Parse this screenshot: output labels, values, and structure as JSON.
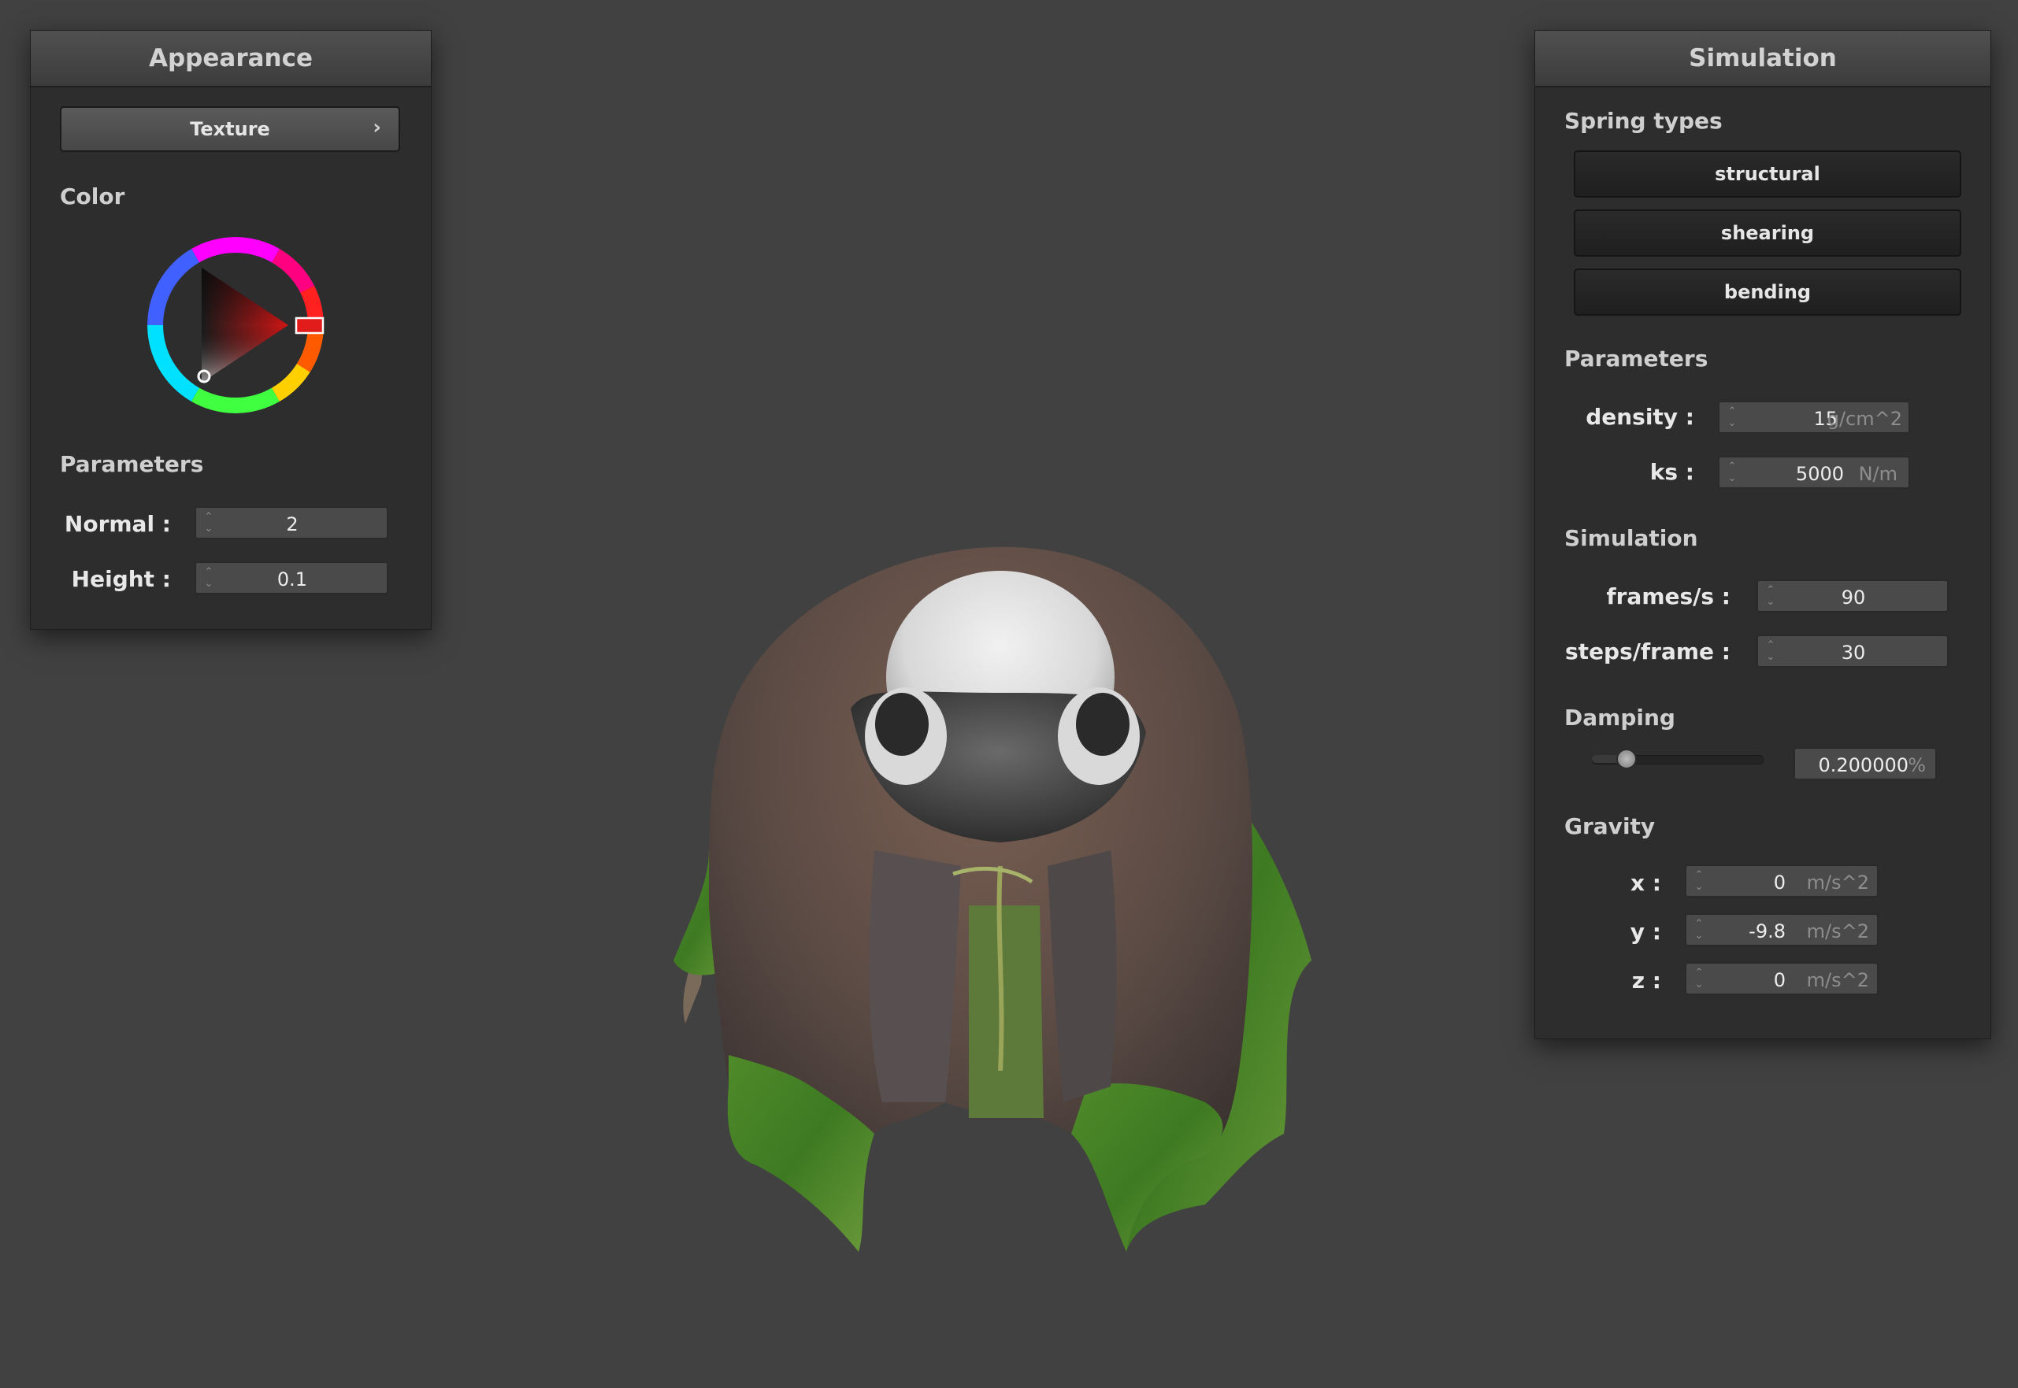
{
  "appearance": {
    "title": "Appearance",
    "texture_button": "Texture",
    "texture_chevron": "›",
    "color_label": "Color",
    "color_wheel": {
      "selected_color": "#d01515",
      "hue_marker_color": "#e21b1b"
    },
    "parameters_label": "Parameters",
    "normal": {
      "label": "Normal :",
      "value": "2"
    },
    "height": {
      "label": "Height :",
      "value": "0.1"
    }
  },
  "simulation": {
    "title": "Simulation",
    "spring_types_label": "Spring types",
    "spring_buttons": [
      "structural",
      "shearing",
      "bending"
    ],
    "parameters_label": "Parameters",
    "density": {
      "label": "density :",
      "value": "15",
      "unit": "g/cm^2"
    },
    "ks": {
      "label": "ks :",
      "value": "5000",
      "unit": "N/m"
    },
    "simulation_label": "Simulation",
    "frames": {
      "label": "frames/s :",
      "value": "90"
    },
    "steps": {
      "label": "steps/frame :",
      "value": "30"
    },
    "damping_label": "Damping",
    "damping": {
      "value": "0.200000",
      "unit": "%",
      "slider_fraction": 0.2
    },
    "gravity_label": "Gravity",
    "gx": {
      "label": "x :",
      "value": "0",
      "unit": "m/s^2"
    },
    "gy": {
      "label": "y :",
      "value": "-9.8",
      "unit": "m/s^2"
    },
    "gz": {
      "label": "z :",
      "value": "0",
      "unit": "m/s^2"
    }
  },
  "viewport": {
    "background": "#414141",
    "object": "cloth draped over sphere, donkey photo texture"
  }
}
